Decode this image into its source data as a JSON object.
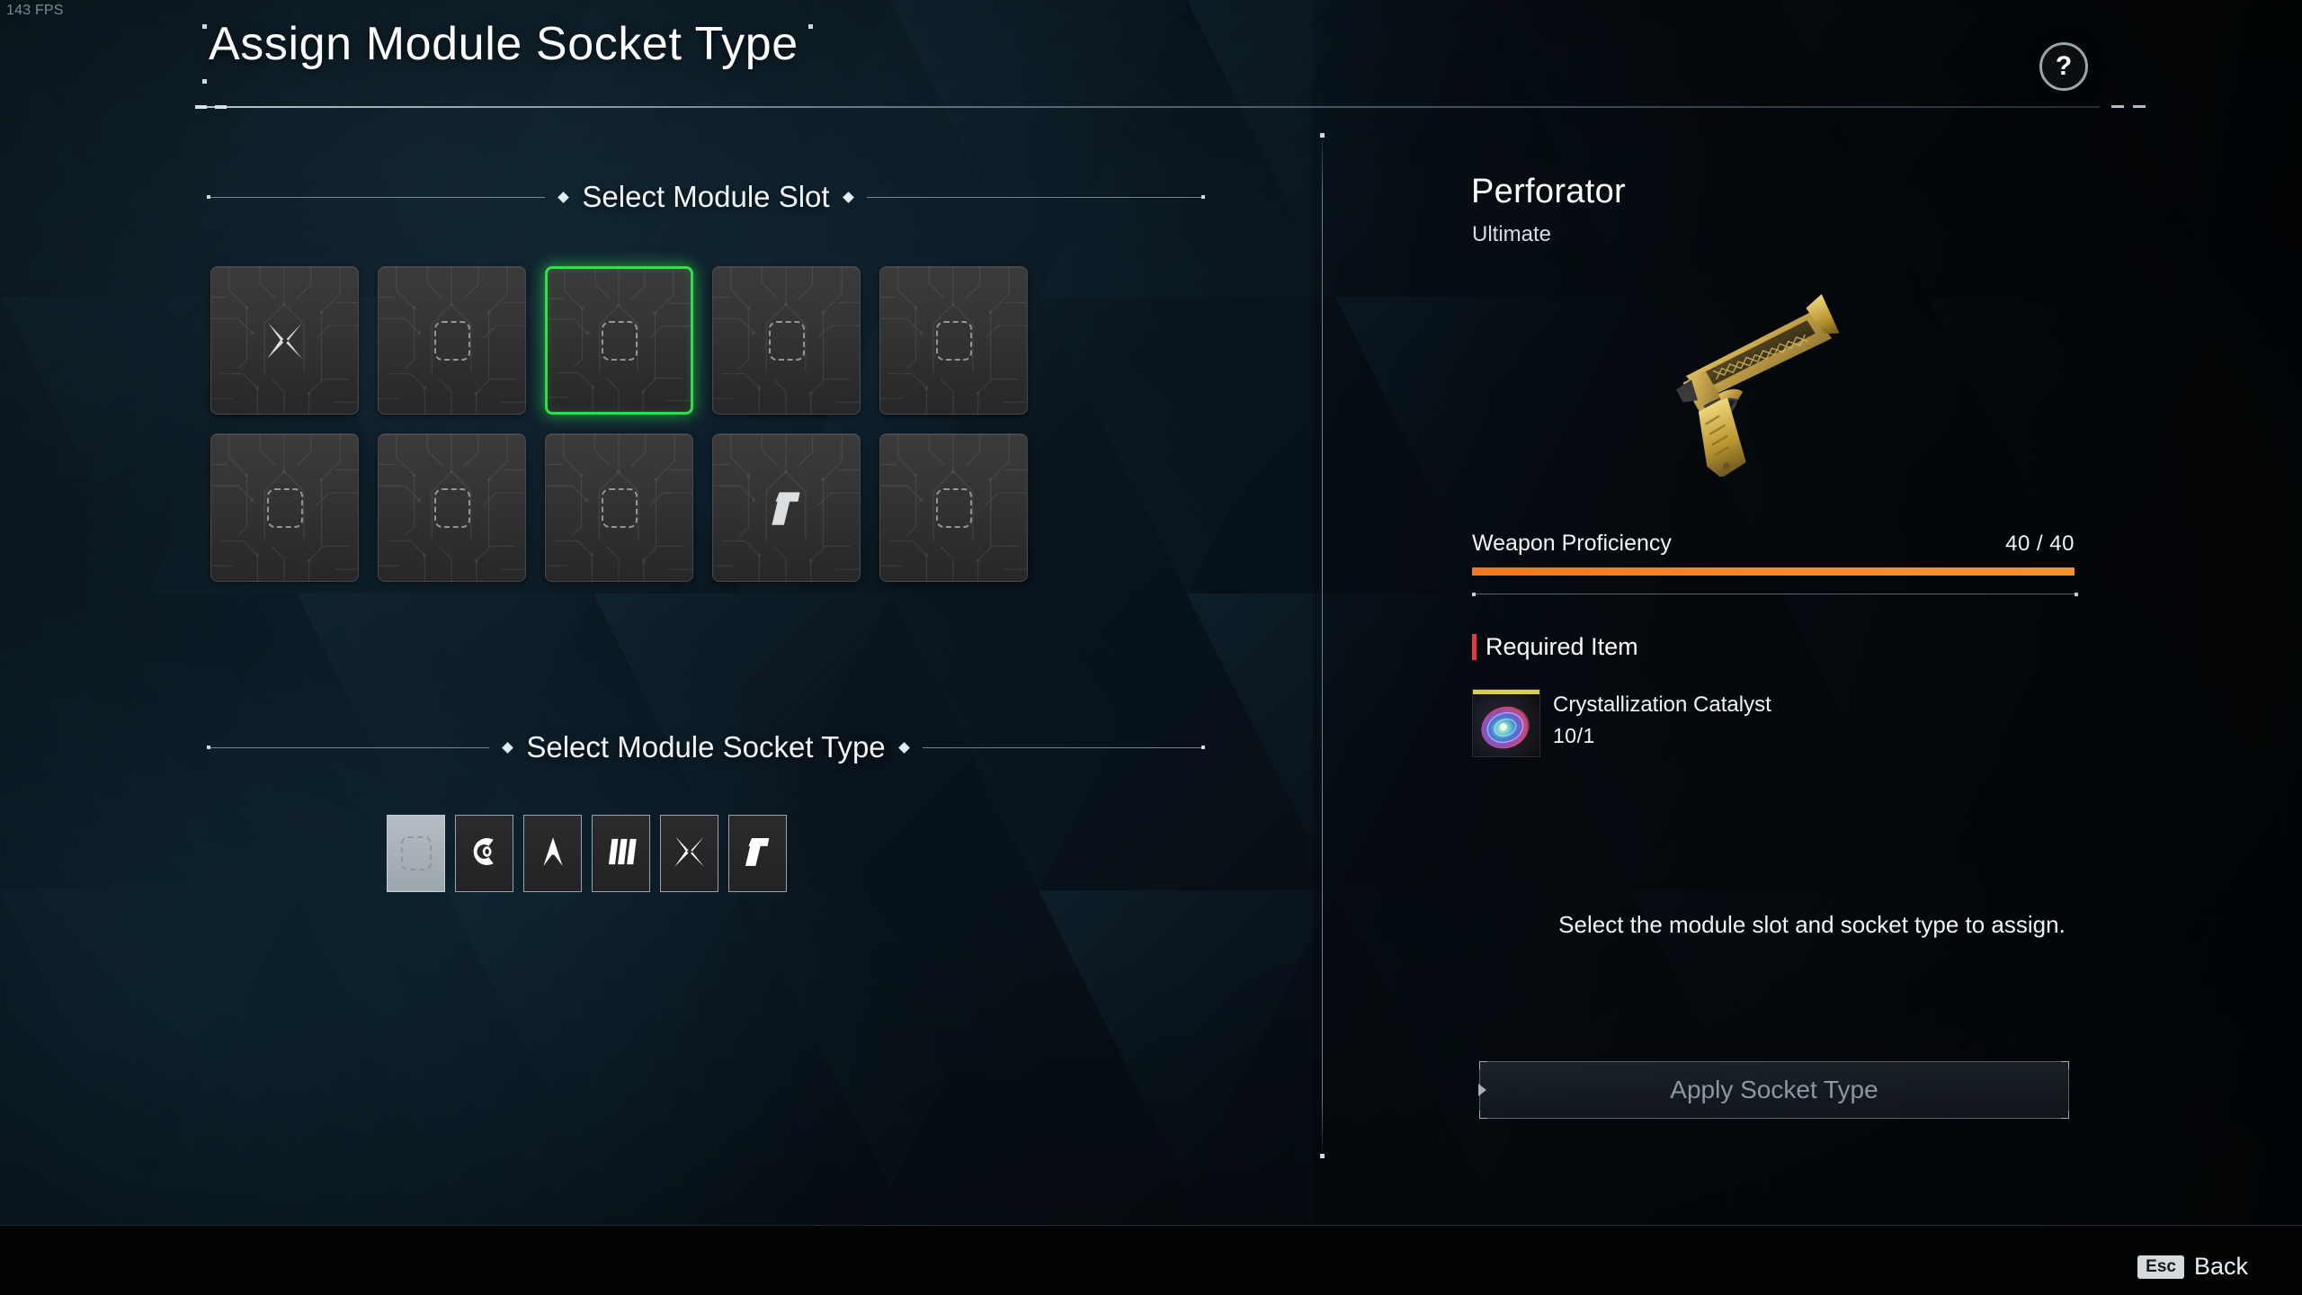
{
  "hud": {
    "fps": "143 FPS"
  },
  "header": {
    "title": "Assign Module Socket Type",
    "help_icon": "?"
  },
  "sections": {
    "module_slot": "Select Module Slot",
    "socket_type": "Select Module Socket Type"
  },
  "module_slots": [
    {
      "index": 1,
      "icon": "xantic-star-icon",
      "state": "filled",
      "selected": false
    },
    {
      "index": 2,
      "icon": "empty-socket-icon",
      "state": "empty",
      "selected": false
    },
    {
      "index": 3,
      "icon": "empty-socket-icon",
      "state": "empty",
      "selected": true
    },
    {
      "index": 4,
      "icon": "empty-socket-icon",
      "state": "empty",
      "selected": false
    },
    {
      "index": 5,
      "icon": "empty-socket-icon",
      "state": "empty",
      "selected": false
    },
    {
      "index": 6,
      "icon": "empty-socket-icon",
      "state": "empty",
      "selected": false
    },
    {
      "index": 7,
      "icon": "empty-socket-icon",
      "state": "empty",
      "selected": false
    },
    {
      "index": 8,
      "icon": "empty-socket-icon",
      "state": "empty",
      "selected": false
    },
    {
      "index": 9,
      "icon": "rutile-r-icon",
      "state": "filled",
      "selected": false
    },
    {
      "index": 10,
      "icon": "empty-socket-icon",
      "state": "empty",
      "selected": false
    }
  ],
  "socket_types": [
    {
      "index": 1,
      "icon": "empty-socket-icon",
      "selected": true
    },
    {
      "index": 2,
      "icon": "cerulean-c-icon",
      "selected": false
    },
    {
      "index": 3,
      "icon": "almandine-arrow-icon",
      "selected": false
    },
    {
      "index": 4,
      "icon": "malachite-bars-icon",
      "selected": false
    },
    {
      "index": 5,
      "icon": "xantic-star-icon",
      "selected": false
    },
    {
      "index": 6,
      "icon": "rutile-r-icon",
      "selected": false
    }
  ],
  "weapon": {
    "name": "Perforator",
    "tier": "Ultimate",
    "image_icon": "golden-handgun-image"
  },
  "proficiency": {
    "label": "Weapon Proficiency",
    "value": "40 / 40",
    "current": 40,
    "max": 40,
    "percent": 100,
    "bar_color": "#f07820"
  },
  "required_item": {
    "heading": "Required Item",
    "accent_color": "#e23b3b",
    "name": "Crystallization Catalyst",
    "count": "10/1",
    "owned": 10,
    "needed": 1,
    "icon": "crystallization-catalyst-icon"
  },
  "hint_text": "Select the module slot and socket type to assign.",
  "apply_button": {
    "label": "Apply Socket Type",
    "enabled": false
  },
  "footer": {
    "key": "Esc",
    "action": "Back"
  },
  "colors": {
    "selection_green": "#2fe04a",
    "proficiency_orange": "#f07820",
    "required_red": "#e23b3b",
    "panel_dark": "#2b2b2d"
  }
}
